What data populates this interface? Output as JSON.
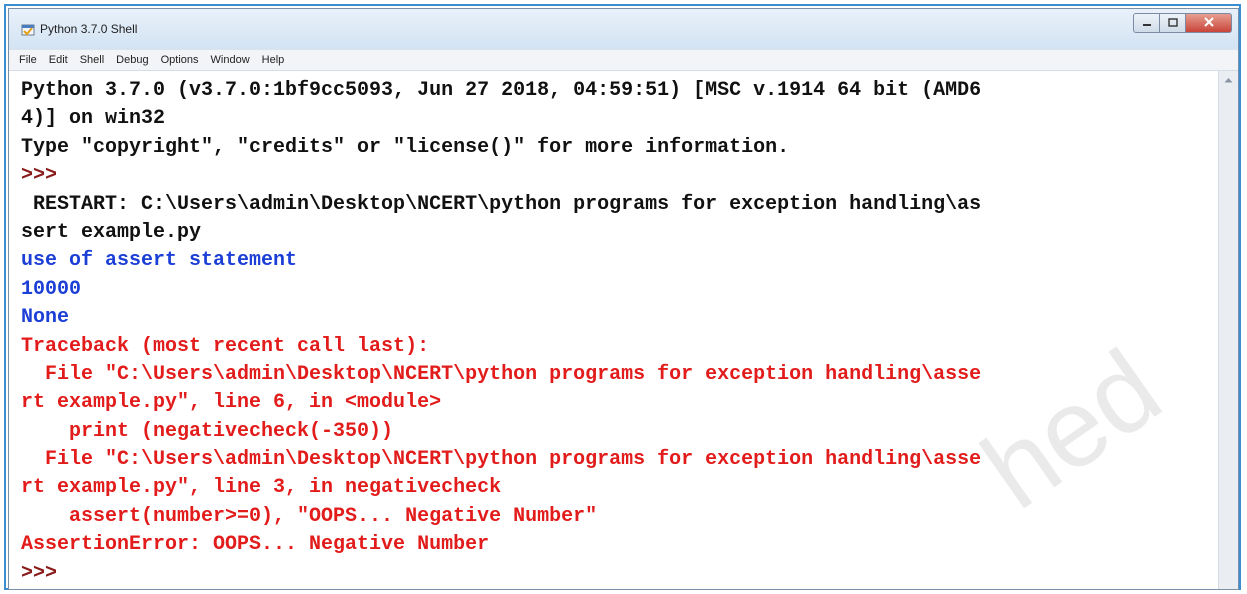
{
  "window": {
    "title": "Python 3.7.0 Shell"
  },
  "menu": [
    "File",
    "Edit",
    "Shell",
    "Debug",
    "Options",
    "Window",
    "Help"
  ],
  "shell": {
    "lines": [
      {
        "text": "Python 3.7.0 (v3.7.0:1bf9cc5093, Jun 27 2018, 04:59:51) [MSC v.1914 64 bit (AMD6",
        "color": "black"
      },
      {
        "text": "4)] on win32",
        "color": "black"
      },
      {
        "text": "Type \"copyright\", \"credits\" or \"license()\" for more information.",
        "color": "black"
      },
      {
        "text": ">>> ",
        "color": "maroon"
      },
      {
        "text": " RESTART: C:\\Users\\admin\\Desktop\\NCERT\\python programs for exception handling\\as",
        "color": "black"
      },
      {
        "text": "sert example.py",
        "color": "black"
      },
      {
        "text": "use of assert statement",
        "color": "blue"
      },
      {
        "text": "10000",
        "color": "blue"
      },
      {
        "text": "None",
        "color": "blue"
      },
      {
        "text": "Traceback (most recent call last):",
        "color": "red"
      },
      {
        "text": "  File \"C:\\Users\\admin\\Desktop\\NCERT\\python programs for exception handling\\asse",
        "color": "red"
      },
      {
        "text": "rt example.py\", line 6, in <module>",
        "color": "red"
      },
      {
        "text": "    print (negativecheck(-350))",
        "color": "red"
      },
      {
        "text": "  File \"C:\\Users\\admin\\Desktop\\NCERT\\python programs for exception handling\\asse",
        "color": "red"
      },
      {
        "text": "rt example.py\", line 3, in negativecheck",
        "color": "red"
      },
      {
        "text": "    assert(number>=0), \"OOPS... Negative Number\"",
        "color": "red"
      },
      {
        "text": "AssertionError: OOPS... Negative Number",
        "color": "red"
      },
      {
        "text": ">>> ",
        "color": "maroon"
      }
    ]
  },
  "watermark": "hed",
  "colors": {
    "black": "#111111",
    "maroon": "#8b1a1a",
    "blue": "#1c3fd6",
    "red": "#e21b1b",
    "border": "#3b8fd0"
  },
  "icons": {
    "app": "python-shell-icon",
    "minimize": "minimize-icon",
    "maximize": "maximize-icon",
    "close": "close-icon",
    "scroll_up": "scroll-up-arrow-icon"
  }
}
